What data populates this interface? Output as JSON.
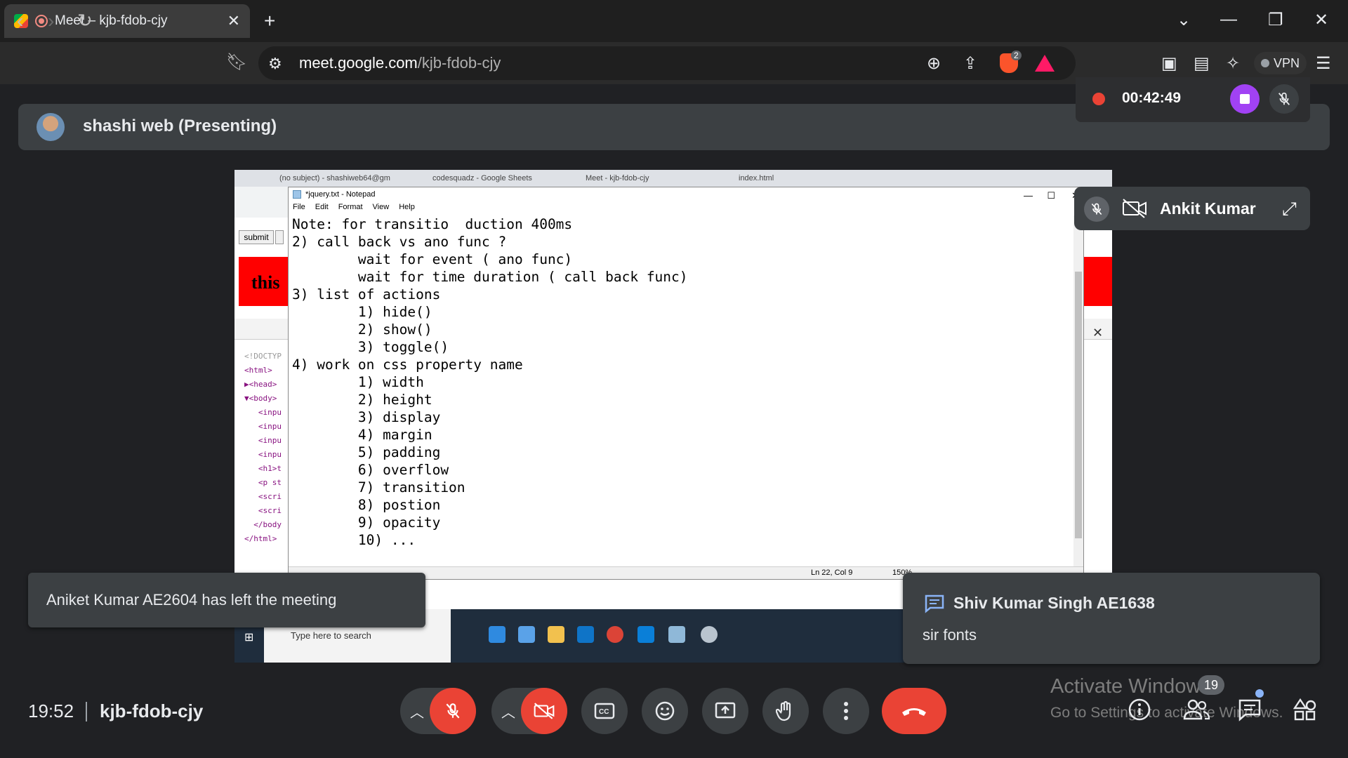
{
  "browser": {
    "tab_title": "Meet – kjb-fdob-cjy",
    "url_domain": "meet.google.com",
    "url_path": "/kjb-fdob-cjy",
    "extension_badge": "2",
    "vpn_label": "VPN"
  },
  "meet": {
    "presenter_banner": "shashi web (Presenting)",
    "recording_time": "00:42:49",
    "tile_name": "Ankit Kumar",
    "clock": "19:52",
    "meeting_code": "kjb-fdob-cjy",
    "participants_count": "19",
    "accent_red": "#ea4335",
    "accent_purple": "#a142f4"
  },
  "shared_screen": {
    "tabs": [
      "(no subject) - shashiweb64@gm",
      "codesquadz - Google Sheets",
      "Meet - kjb-fdob-cjy",
      "index.html"
    ],
    "submit_label": "submit",
    "red_text": "this",
    "dom_lines": [
      "<!DOCTYP",
      "<html>",
      "▶<head>",
      "▼<body>",
      "   <inpu",
      "   <inpu",
      "   <inpu",
      "   <inpu",
      "   <h1>t",
      "   <p st",
      "   <scri",
      "   <scri",
      "  </body",
      "</html>"
    ],
    "notepad_title": "*jquery.txt - Notepad",
    "notepad_menu": [
      "File",
      "Edit",
      "Format",
      "View",
      "Help"
    ],
    "notepad_lines": [
      "Note: for transitio  duction 400ms",
      "2) call back vs ano func ?",
      "        wait for event ( ano func)",
      "        wait for time duration ( call back func)",
      "3) list of actions",
      "        1) hide()",
      "        2) show()",
      "        3) toggle()",
      "4) work on css property name",
      "        1) width",
      "        2) height",
      "        3) display",
      "        4) margin",
      "        5) padding",
      "        6) overflow",
      "        7) transition",
      "        8) postion",
      "        9) opacity",
      "        10) ..."
    ],
    "status_pos": "Ln 22, Col 9",
    "status_zoom": "150%",
    "taskbar_search": "Type here to search"
  },
  "toasts": {
    "left_notice": "Aniket Kumar AE2604 has left the meeting",
    "chat_sender": "Shiv Kumar Singh AE1638",
    "chat_message": "sir fonts"
  },
  "watermark": {
    "line1": "Activate Windows",
    "line2": "Go to Settings to activate Windows."
  }
}
